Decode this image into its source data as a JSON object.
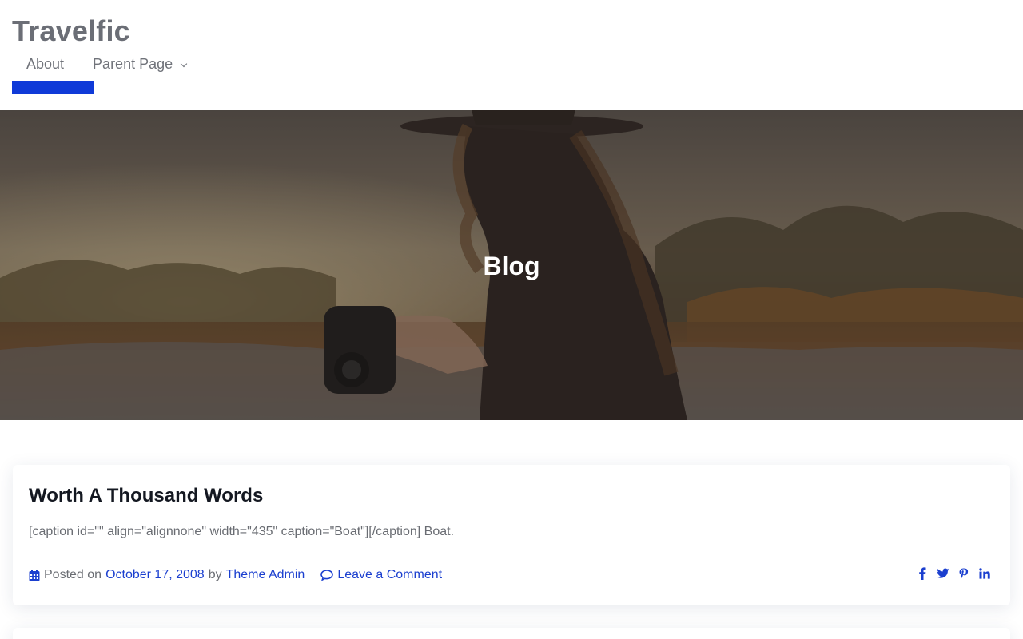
{
  "site": {
    "title": "Travelfic"
  },
  "nav": {
    "items": [
      {
        "label": "About"
      },
      {
        "label": "Parent Page"
      }
    ],
    "accent_color": "#0f3ad8"
  },
  "hero": {
    "title": "Blog"
  },
  "posts": [
    {
      "title": "Worth A Thousand Words",
      "excerpt": "[caption id=\"\" align=\"alignnone\" width=\"435\" caption=\"Boat\"][/caption] Boat.",
      "meta": {
        "posted_on_label": "Posted on",
        "date": "October 17, 2008",
        "by_label": "by",
        "author": "Theme Admin",
        "comment_label": "Leave a Comment"
      },
      "social_icons": [
        "facebook-icon",
        "twitter-icon",
        "pinterest-icon",
        "linkedin-icon"
      ]
    }
  ],
  "colors": {
    "link": "#1b3fcf",
    "title": "#141821"
  }
}
